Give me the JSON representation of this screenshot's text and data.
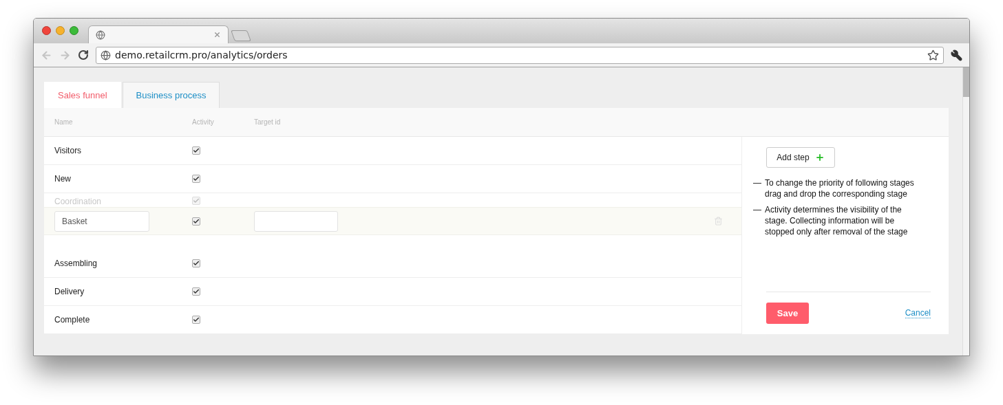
{
  "browser": {
    "url": "demo.retailcrm.pro/analytics/orders"
  },
  "tabs": [
    {
      "label": "Sales funnel",
      "selected": true
    },
    {
      "label": "Business process",
      "selected": false
    }
  ],
  "columns": [
    "Name",
    "Activity",
    "Target id"
  ],
  "rows": [
    {
      "kind": "row",
      "name": "Visitors",
      "active": true
    },
    {
      "kind": "row",
      "name": "New",
      "active": true
    },
    {
      "kind": "ghost",
      "name": "Coordination",
      "active": true
    },
    {
      "kind": "placeholder"
    },
    {
      "kind": "row",
      "name": "Assembling",
      "active": true
    },
    {
      "kind": "row",
      "name": "Delivery",
      "active": true
    },
    {
      "kind": "row",
      "name": "Complete",
      "active": true
    }
  ],
  "dragged_row": {
    "name": "Basket",
    "active": true
  },
  "sidebar": {
    "add_step": "Add step",
    "notes": [
      "To change the priority of following stages drag and drop the corresponding stage",
      "Activity determines the visibility of the stage. Collecting information will be stopped only after removal of the stage"
    ],
    "note_dash": "—",
    "save": "Save",
    "cancel": "Cancel"
  }
}
